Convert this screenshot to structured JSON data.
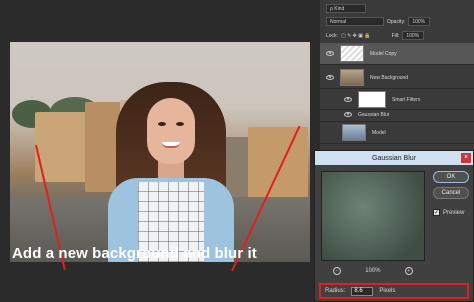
{
  "caption": "Add a new background and blur it",
  "layers_panel": {
    "kind_filter": "ρ Kind",
    "blend_mode": "Normal",
    "opacity_label": "Opacity:",
    "opacity_value": "100%",
    "lock_label": "Lock:",
    "fill_label": "Fill:",
    "fill_value": "100%",
    "layers": [
      {
        "name": "Model Copy",
        "visible": true,
        "selected": true
      },
      {
        "name": "New Background",
        "visible": true,
        "selected": false
      },
      {
        "name": "Smart Filters",
        "visible": true,
        "selected": false
      },
      {
        "name": "Gaussian Blur",
        "visible": true,
        "selected": false
      },
      {
        "name": "Model",
        "visible": false,
        "selected": false
      }
    ]
  },
  "dialog": {
    "title": "Gaussian Blur",
    "ok_label": "OK",
    "cancel_label": "Cancel",
    "preview_label": "Preview",
    "zoom_value": "100%",
    "radius_label": "Radius:",
    "radius_value": "8.6",
    "radius_unit": "Pixels"
  },
  "colors": {
    "accent_red": "#e0201f",
    "dialog_title": "#cfe0f1"
  },
  "icons": [
    "eye-icon",
    "zoom-in-icon",
    "zoom-out-icon",
    "close-icon",
    "lock-icon"
  ]
}
